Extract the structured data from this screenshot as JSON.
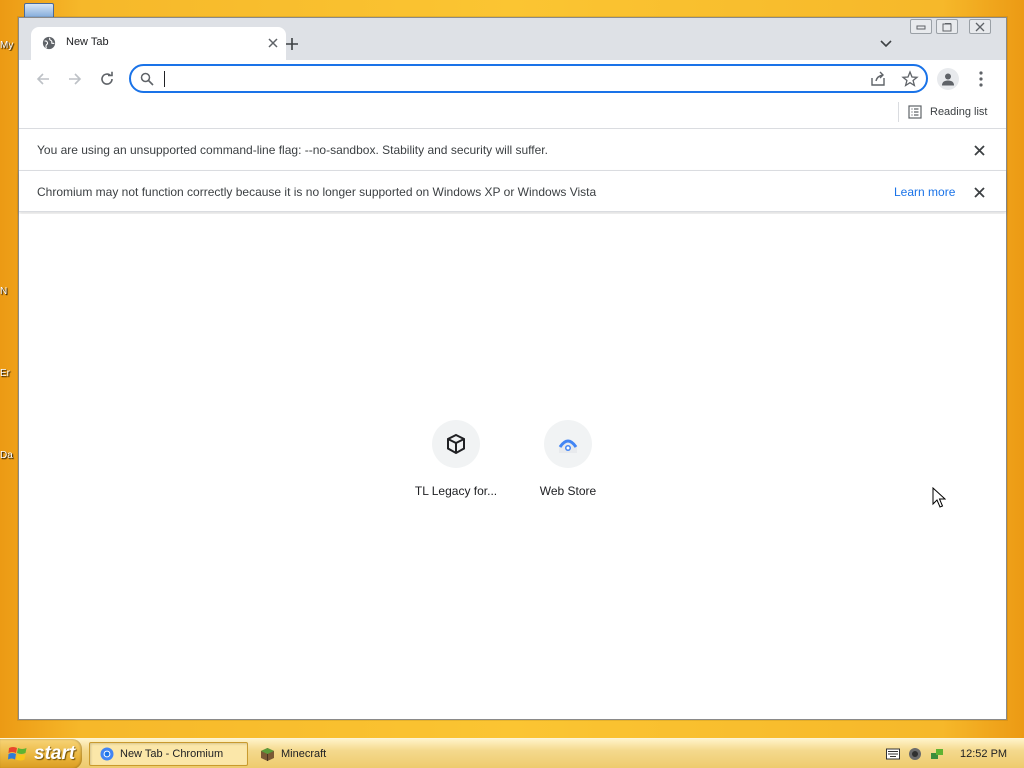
{
  "desktop": {
    "edge_labels": [
      "My",
      "N",
      "Er",
      "Da"
    ]
  },
  "browser": {
    "tab": {
      "title": "New Tab"
    },
    "omnibox": {
      "value": "",
      "placeholder": ""
    },
    "bookmarks_bar": {
      "reading_list_label": "Reading list"
    },
    "infobars": [
      {
        "message": "You are using an unsupported command-line flag: --no-sandbox. Stability and security will suffer.",
        "link": ""
      },
      {
        "message": "Chromium may not function correctly because it is no longer supported on Windows XP or Windows Vista",
        "link": "Learn more"
      }
    ],
    "shortcuts": [
      {
        "label": "TL Legacy for...",
        "icon": "cube-icon"
      },
      {
        "label": "Web Store",
        "icon": "web-store-icon"
      }
    ]
  },
  "taskbar": {
    "start_label": "start",
    "items": [
      {
        "label": "New Tab - Chromium",
        "icon": "chromium-icon",
        "active": true
      },
      {
        "label": "Minecraft",
        "icon": "minecraft-icon",
        "active": false
      }
    ],
    "clock": "12:52 PM"
  },
  "colors": {
    "accent": "#1a73e8",
    "desktop": "#fbc532",
    "taskbar": "#f4d98d"
  }
}
